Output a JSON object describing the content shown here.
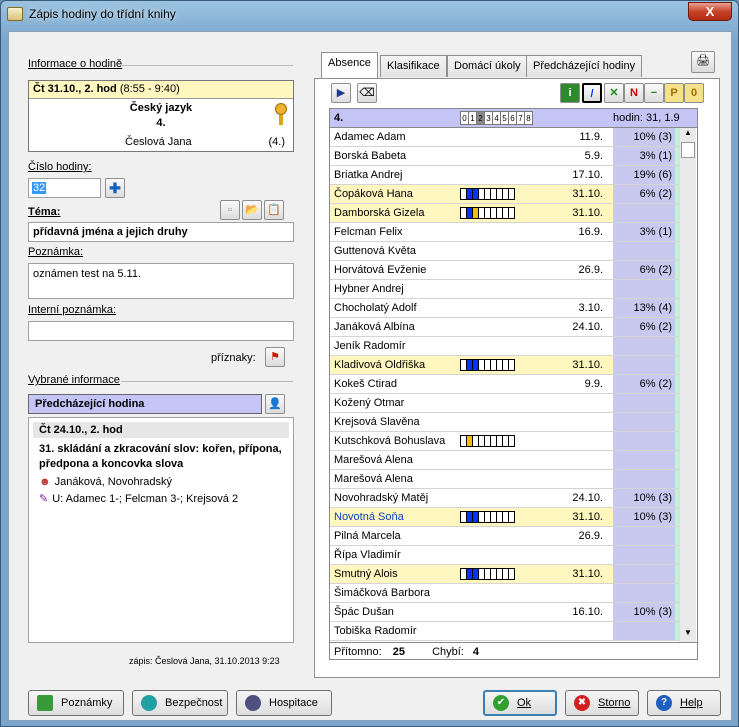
{
  "window": {
    "title": "Zápis hodiny do třídní knihy",
    "close": "X"
  },
  "left": {
    "info_label": "Informace o hodině",
    "lesson_header": "Čt 31.10., 2. hod",
    "lesson_time": "(8:55 - 9:40)",
    "subject": "Český jazyk",
    "class": "4.",
    "teacher": "Česlová Jana",
    "teacher_class": "(4.)",
    "number_label": "Číslo hodiny:",
    "number_value": "32",
    "topic_label": "Téma:",
    "topic_value": "přídavná jména a jejich druhy",
    "note_label": "Poznámka:",
    "note_value": "oznámen test na 5.11.",
    "internal_label": "Interní poznámka:",
    "internal_value": "",
    "flags_label": "příznaky:",
    "selected_label": "Vybrané informace",
    "prev_header": "Předcházející hodina",
    "prev_lesson": "Čt 24.10., 2. hod",
    "prev_topic": "31. skládání a zkracování slov: kořen, přípona, předpona a koncovka slova",
    "prev_teachers": "Janáková, Novohradský",
    "prev_grades": "U: Adamec 1-; Felcman 3-; Krejsová 2",
    "record": "zápis: Česlová Jana, 31.10.2013 9:23"
  },
  "tabs": [
    "Absence",
    "Klasifikace",
    "Domácí úkoly",
    "Předcházející hodiny"
  ],
  "grid": {
    "class": "4.",
    "hours": [
      "0",
      "1",
      "2",
      "3",
      "4",
      "5",
      "6",
      "7",
      "8"
    ],
    "hours_label": "hodin: 31, 1.9",
    "students": [
      {
        "name": "Adamec Adam",
        "date": "11.9.",
        "pct": "10% (3)"
      },
      {
        "name": "Borská Babeta",
        "date": "5.9.",
        "pct": "3% (1)"
      },
      {
        "name": "Briatka Andrej",
        "date": "17.10.",
        "pct": "19% (6)"
      },
      {
        "name": "Čopáková Hana",
        "date": "31.10.",
        "pct": "6% (2)",
        "hl": true,
        "bars": "bb"
      },
      {
        "name": "Damborská Gizela",
        "date": "31.10.",
        "pct": "",
        "hl": true,
        "bars": "bo"
      },
      {
        "name": "Felcman Felix",
        "date": "16.9.",
        "pct": "3% (1)"
      },
      {
        "name": "Guttenová Květa",
        "date": "",
        "pct": ""
      },
      {
        "name": "Horvátová Evženie",
        "date": "26.9.",
        "pct": "6% (2)"
      },
      {
        "name": "Hybner Andrej",
        "date": "",
        "pct": ""
      },
      {
        "name": "Chocholatý Adolf",
        "date": "3.10.",
        "pct": "13% (4)"
      },
      {
        "name": "Janáková Albína",
        "date": "24.10.",
        "pct": "6% (2)"
      },
      {
        "name": "Jeník Radomír",
        "date": "",
        "pct": ""
      },
      {
        "name": "Kladivová Oldřiška",
        "date": "31.10.",
        "pct": "",
        "hl": true,
        "bars": "bb"
      },
      {
        "name": "Kokeš Ctirad",
        "date": "9.9.",
        "pct": "6% (2)"
      },
      {
        "name": "Kožený Otmar",
        "date": "",
        "pct": ""
      },
      {
        "name": "Krejsová Slavěna",
        "date": "",
        "pct": ""
      },
      {
        "name": "Kutschková Bohuslava",
        "date": "",
        "pct": "",
        "bars": "o"
      },
      {
        "name": "Marešová Alena",
        "date": "",
        "pct": ""
      },
      {
        "name": "Marešová Alena",
        "date": "",
        "pct": ""
      },
      {
        "name": "Novohradský Matěj",
        "date": "24.10.",
        "pct": "10% (3)"
      },
      {
        "name": "Novotná Soňa",
        "date": "31.10.",
        "pct": "10% (3)",
        "hl": true,
        "bars": "bb"
      },
      {
        "name": "Pilná Marcela",
        "date": "26.9.",
        "pct": ""
      },
      {
        "name": "Řípa Vladimír",
        "date": "",
        "pct": ""
      },
      {
        "name": "Smutný Alois",
        "date": "31.10.",
        "pct": "",
        "hl": true,
        "bars": "bb"
      },
      {
        "name": "Šimáčková Barbora",
        "date": "",
        "pct": ""
      },
      {
        "name": "Špác Dušan",
        "date": "16.10.",
        "pct": "10% (3)"
      },
      {
        "name": "Tobiška Radomír",
        "date": "",
        "pct": ""
      }
    ],
    "present_label": "Přítomno:",
    "present": "25",
    "missing_label": "Chybí:",
    "missing": "4"
  },
  "buttons": {
    "notes": "Poznámky",
    "security": "Bezpečnost",
    "inspection": "Hospitace",
    "ok": "Ok",
    "cancel": "Storno",
    "help": "Help"
  }
}
